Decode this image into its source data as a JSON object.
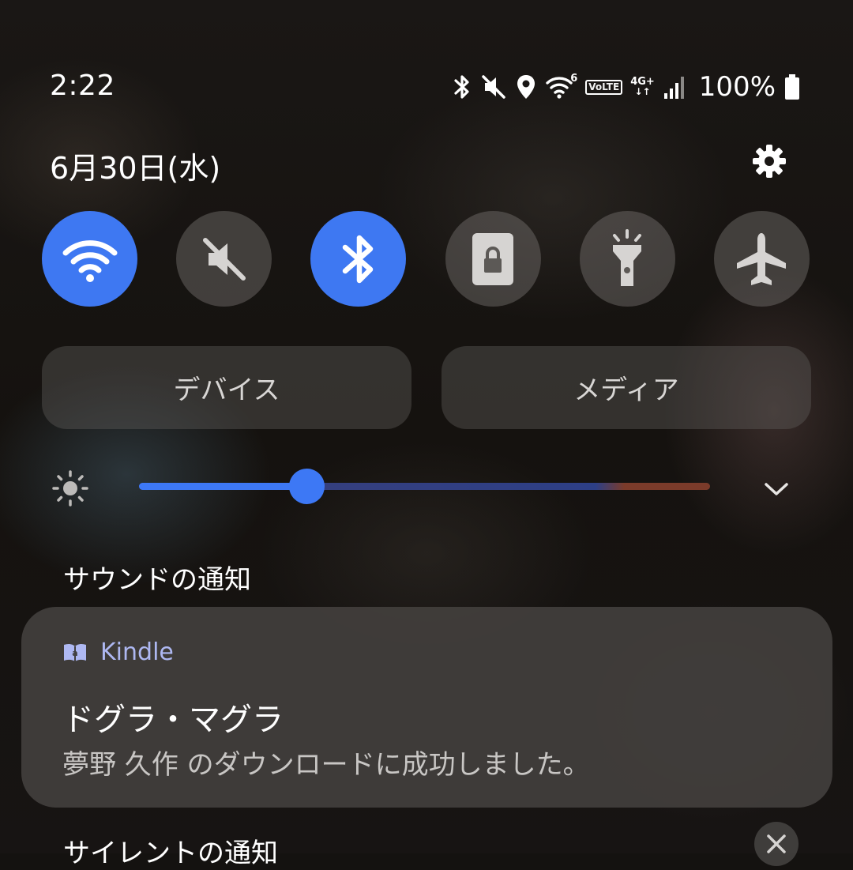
{
  "status_bar": {
    "time": "2:22",
    "wifi_superscript": "6",
    "volte_label": "VoLTE",
    "network_label": "4G+",
    "battery_percent": "100%",
    "icons": [
      "bluetooth-icon",
      "mute-icon",
      "location-icon",
      "wifi-icon",
      "volte-icon",
      "mobile-data-icon",
      "signal-icon",
      "battery-icon"
    ]
  },
  "header": {
    "date": "6月30日(水)",
    "settings_icon": "gear-icon"
  },
  "quick_toggles": [
    {
      "name": "wifi",
      "icon": "wifi-icon",
      "active": true
    },
    {
      "name": "sound",
      "icon": "mute-icon",
      "active": false
    },
    {
      "name": "bluetooth",
      "icon": "bluetooth-icon",
      "active": true
    },
    {
      "name": "auto-rotate-lock",
      "icon": "portrait-lock-icon",
      "active": false
    },
    {
      "name": "flashlight",
      "icon": "flashlight-icon",
      "active": false
    },
    {
      "name": "airplane-mode",
      "icon": "airplane-icon",
      "active": false
    }
  ],
  "buttons": {
    "devices": "デバイス",
    "media": "メディア"
  },
  "brightness": {
    "level": 0.29,
    "accent_color": "#3d78f5"
  },
  "notifications": {
    "sound_section_title": "サウンドの通知",
    "silent_section_title": "サイレントの通知",
    "items": [
      {
        "app": "Kindle",
        "app_icon": "kindle-book-icon",
        "title": "ドグラ・マグラ",
        "body": "夢野 久作 のダウンロードに成功しました。"
      }
    ]
  },
  "colors": {
    "active_toggle": "#3e78f2",
    "app_name": "#aeb8f2"
  }
}
